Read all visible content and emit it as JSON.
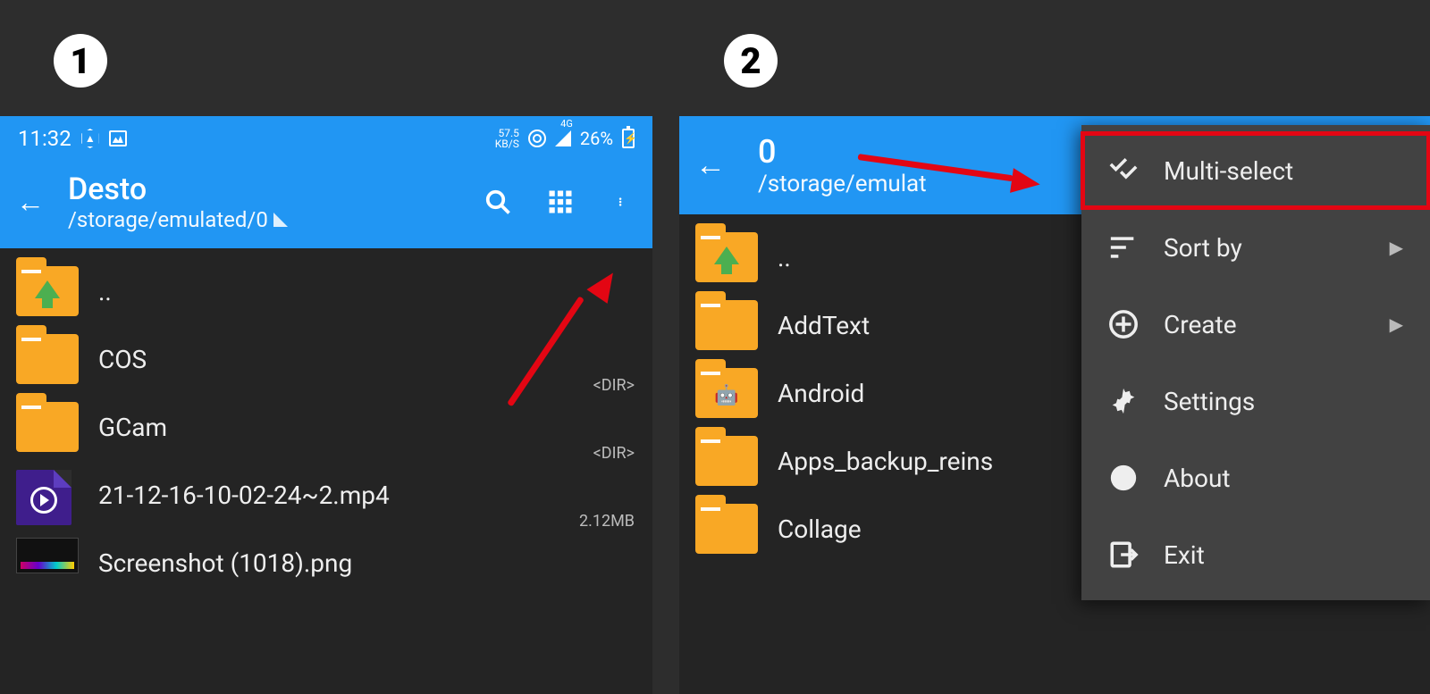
{
  "step_labels": {
    "one": "1",
    "two": "2"
  },
  "screen1": {
    "status": {
      "time": "11:32",
      "kbps_value": "57.5",
      "kbps_unit": "KB/S",
      "network": "4G",
      "battery": "26%"
    },
    "appbar": {
      "title": "Desto",
      "path": "/storage/emulated/0"
    },
    "rows": {
      "up": "..",
      "cos": "COS",
      "cos_meta": "<DIR>",
      "gcam": "GCam",
      "gcam_meta": "<DIR>",
      "video": "21-12-16-10-02-24~2.mp4",
      "video_meta": "2.12MB",
      "shot": "Screenshot (1018).png"
    }
  },
  "screen2": {
    "appbar": {
      "selected_count": "0",
      "path": "/storage/emulat"
    },
    "rows": {
      "up": "..",
      "addtext": "AddText",
      "android": "Android",
      "apps_backup": "Apps_backup_reins",
      "collage": "Collage"
    },
    "menu": {
      "multiselect": "Multi-select",
      "sortby": "Sort by",
      "create": "Create",
      "settings": "Settings",
      "about": "About",
      "exit": "Exit"
    }
  }
}
